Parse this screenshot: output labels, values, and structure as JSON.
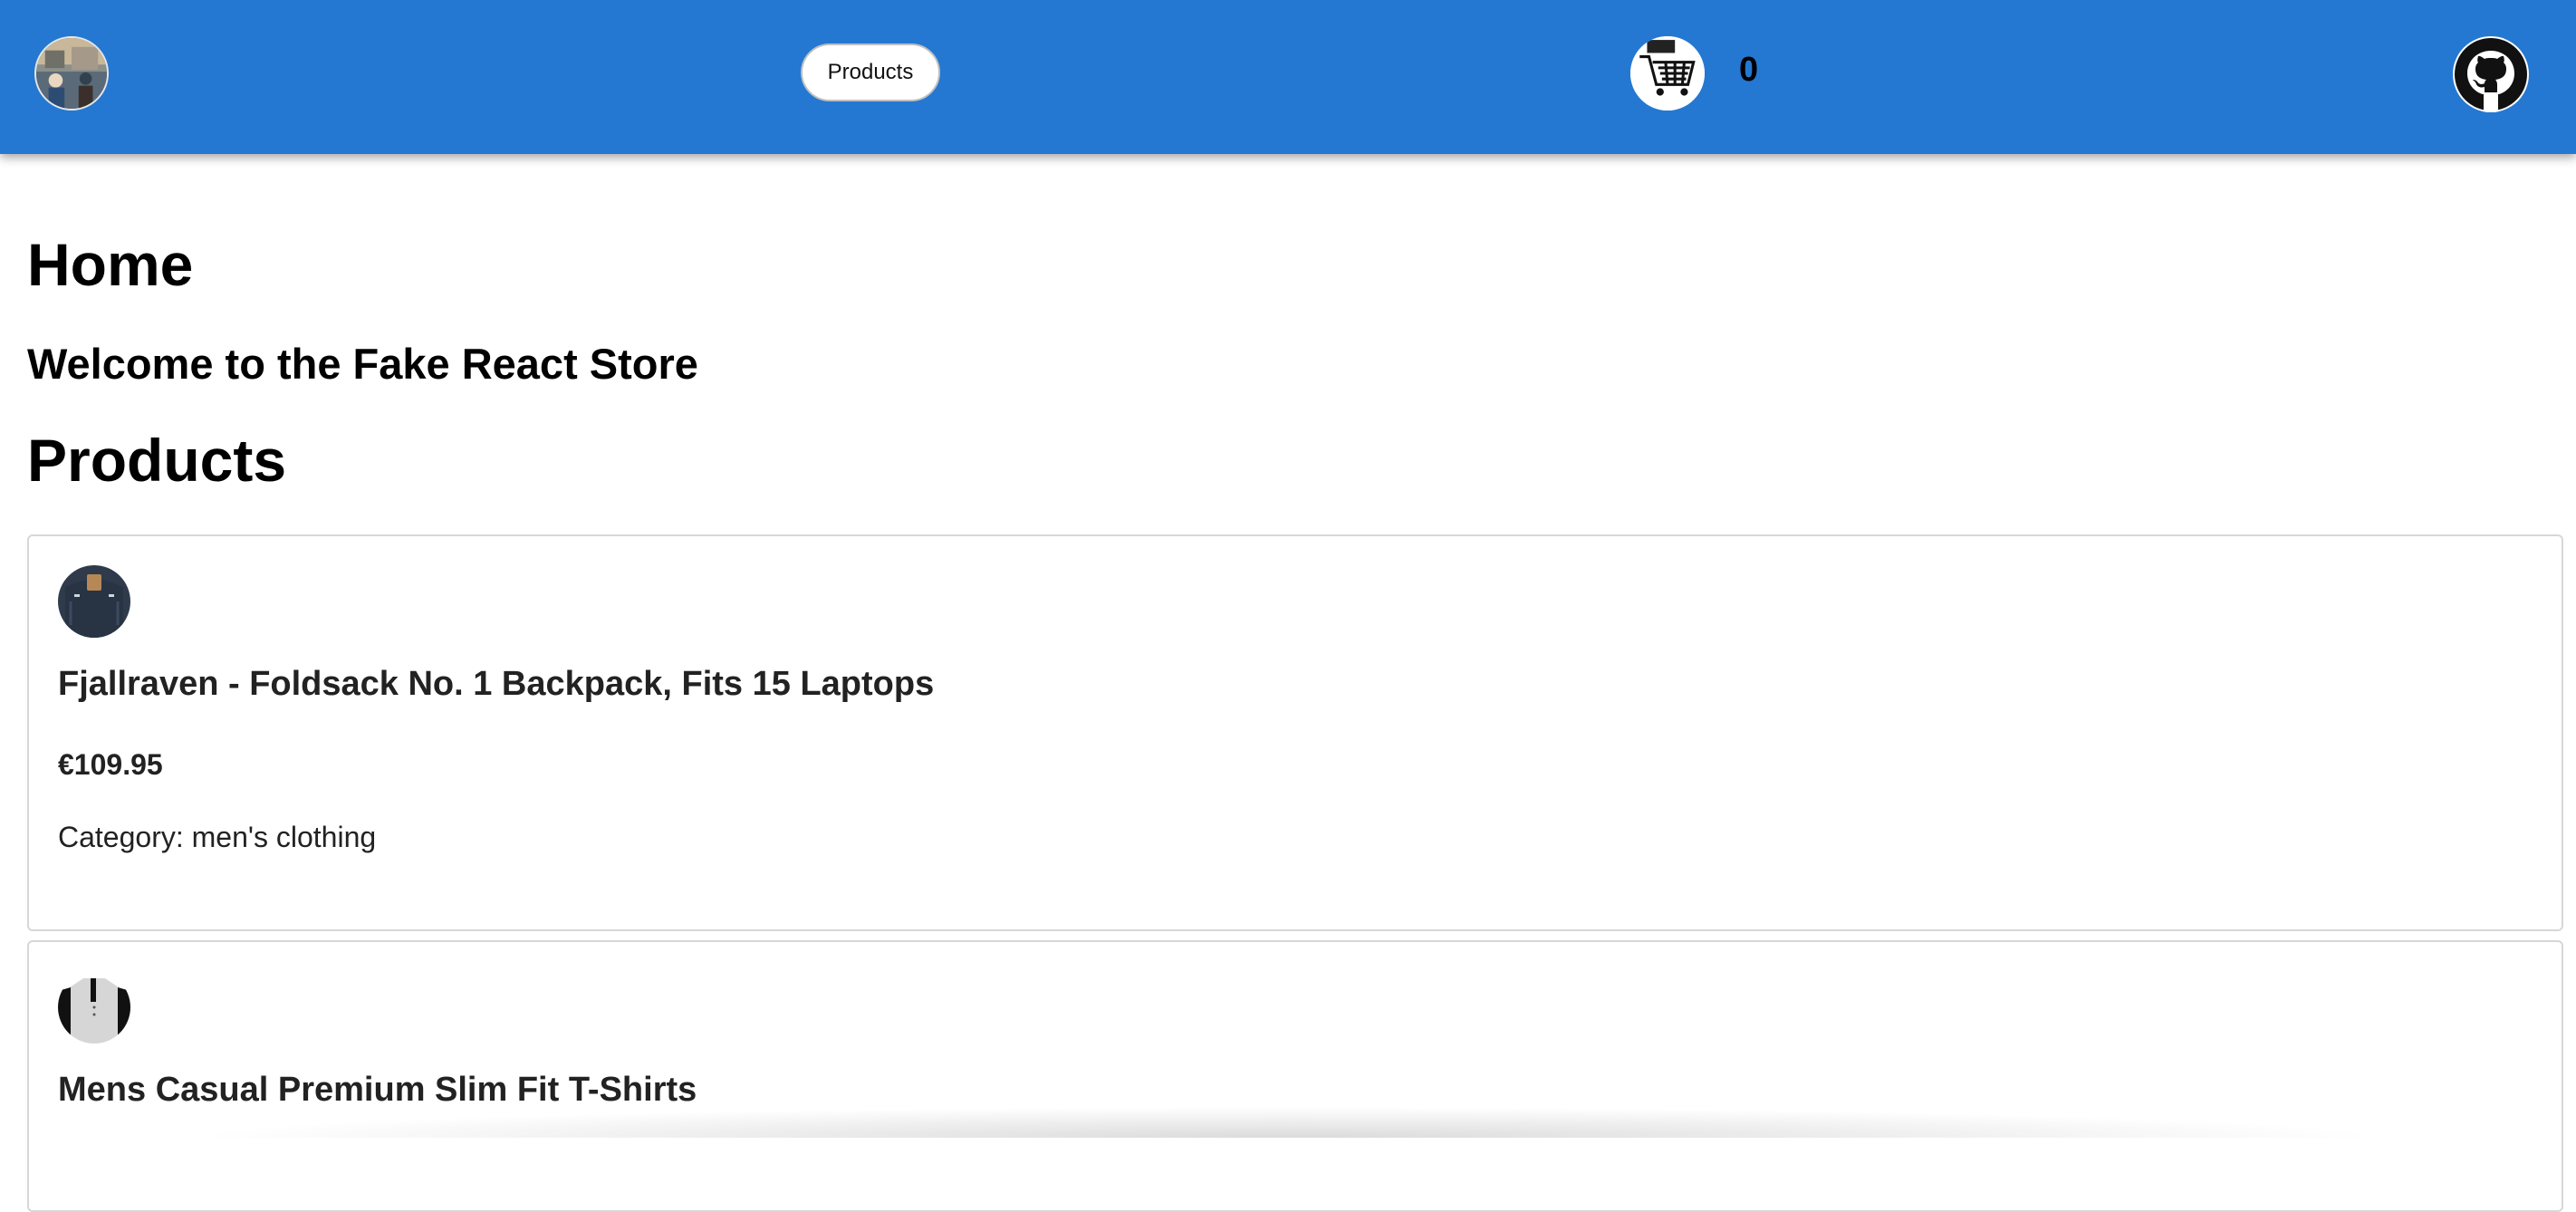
{
  "header": {
    "nav_products_label": "Products",
    "cart_count": "0",
    "icons": {
      "avatar": "store-avatar-icon",
      "cart": "shopping-cart-icon",
      "github": "github-icon"
    },
    "colors": {
      "header_bg": "#2478d2"
    }
  },
  "main": {
    "home_heading": "Home",
    "welcome_text": "Welcome to the Fake React Store",
    "products_heading": "Products",
    "products": [
      {
        "title": "Fjallraven - Foldsack No. 1 Backpack, Fits 15 Laptops",
        "price": "€109.95",
        "category_text": "Category: men's clothing",
        "thumbnail": "backpack-image"
      },
      {
        "title": "Mens Casual Premium Slim Fit T-Shirts",
        "thumbnail": "tshirt-image"
      }
    ]
  }
}
